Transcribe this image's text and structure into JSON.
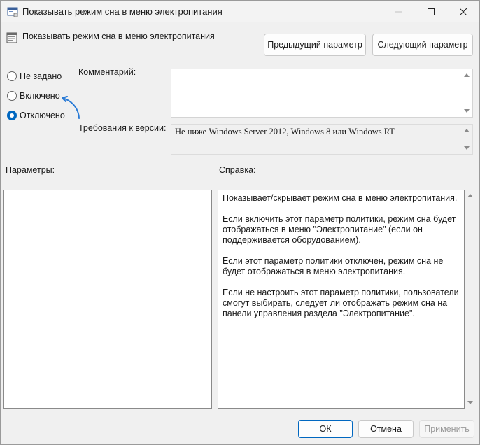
{
  "window": {
    "title": "Показывать режим сна в меню электропитания"
  },
  "header": {
    "policy_name": "Показывать режим сна в меню электропитания",
    "prev_button": "Предыдущий параметр",
    "next_button": "Следующий параметр"
  },
  "state_options": [
    {
      "label": "Не задано",
      "checked": false
    },
    {
      "label": "Включено",
      "checked": false
    },
    {
      "label": "Отключено",
      "checked": true
    }
  ],
  "comment": {
    "label": "Комментарий:",
    "value": ""
  },
  "requirements": {
    "label": "Требования к версии:",
    "value": "Не ниже Windows Server 2012, Windows 8 или Windows RT"
  },
  "params_label": "Параметры:",
  "help": {
    "label": "Справка:",
    "paragraphs": [
      "Показывает/скрывает режим сна в меню электропитания.",
      "Если включить этот параметр политики, режим сна будет отображаться в меню \"Электропитание\" (если он поддерживается оборудованием).",
      "Если этот параметр политики отключен, режим сна не будет отображаться в меню электропитания.",
      "Если не настроить этот параметр политики, пользователи смогут выбирать, следует ли отображать режим сна на панели управления раздела \"Электропитание\"."
    ]
  },
  "footer": {
    "ok": "ОК",
    "cancel": "Отмена",
    "apply": "Применить"
  },
  "colors": {
    "accent": "#0067c0",
    "annotation_arrow": "#2a7bd6"
  },
  "icons": {
    "window": "policy-window-icon",
    "header": "policy-setting-icon"
  }
}
